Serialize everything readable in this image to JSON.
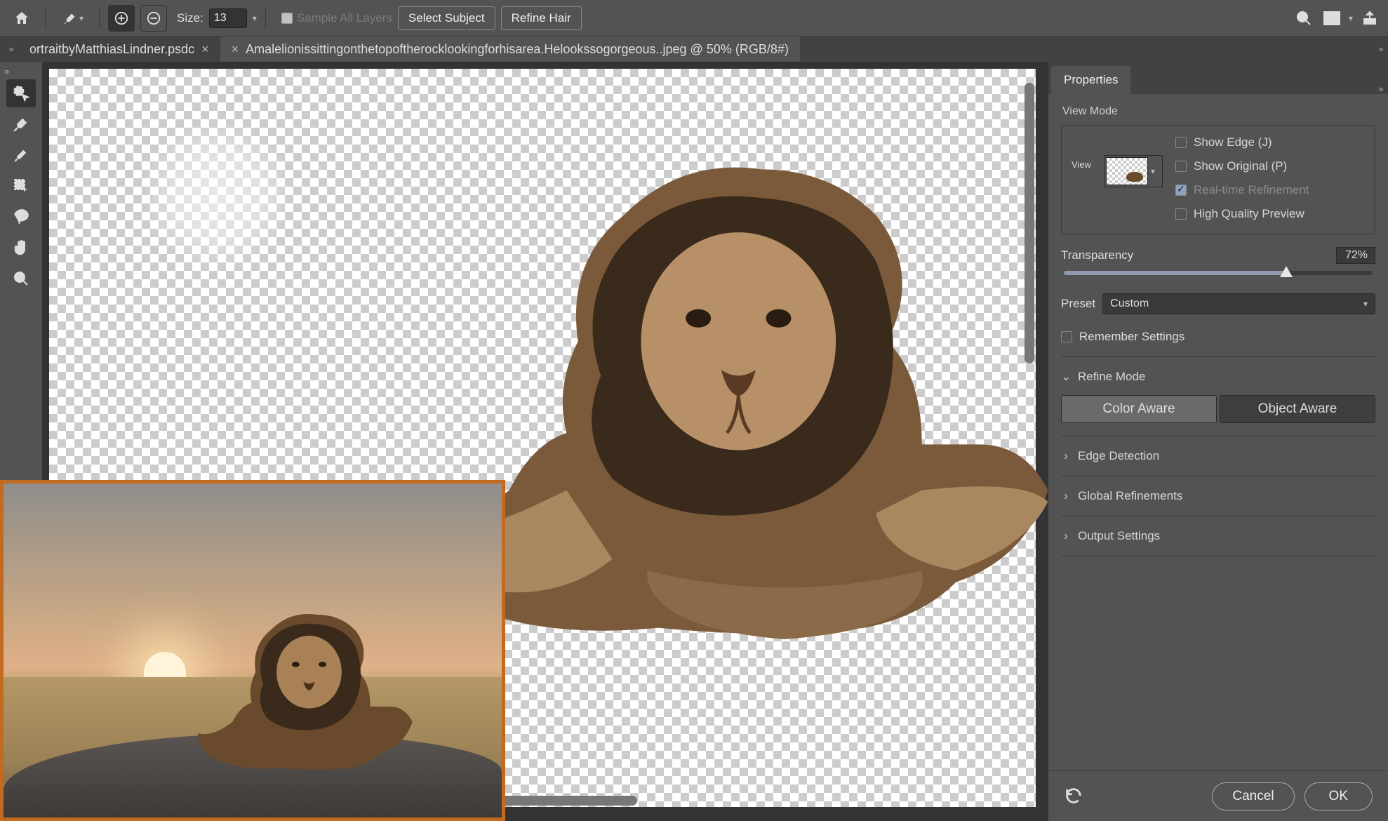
{
  "topbar": {
    "size_label": "Size:",
    "size_value": "13",
    "sample_all_layers": "Sample All Layers",
    "select_subject": "Select Subject",
    "refine_hair": "Refine Hair"
  },
  "tabs": {
    "tab1": "ortraitbyMatthiasLindner.psdc",
    "tab2": "Amalelionissittingonthetopoftherocklookingforhisarea.Helookssogorgeous..jpeg @ 50% (RGB/8#)"
  },
  "panel": {
    "tab": "Properties",
    "view_mode_title": "View Mode",
    "view_label": "View",
    "show_edge": "Show Edge (J)",
    "show_original": "Show Original (P)",
    "realtime": "Real-time Refinement",
    "hq_preview": "High Quality Preview",
    "transparency_label": "Transparency",
    "transparency_value": "72%",
    "preset_label": "Preset",
    "preset_value": "Custom",
    "remember": "Remember Settings",
    "refine_mode": "Refine Mode",
    "color_aware": "Color Aware",
    "object_aware": "Object Aware",
    "edge_detection": "Edge Detection",
    "global_refinements": "Global Refinements",
    "output_settings": "Output Settings"
  },
  "footer": {
    "cancel": "Cancel",
    "ok": "OK"
  }
}
